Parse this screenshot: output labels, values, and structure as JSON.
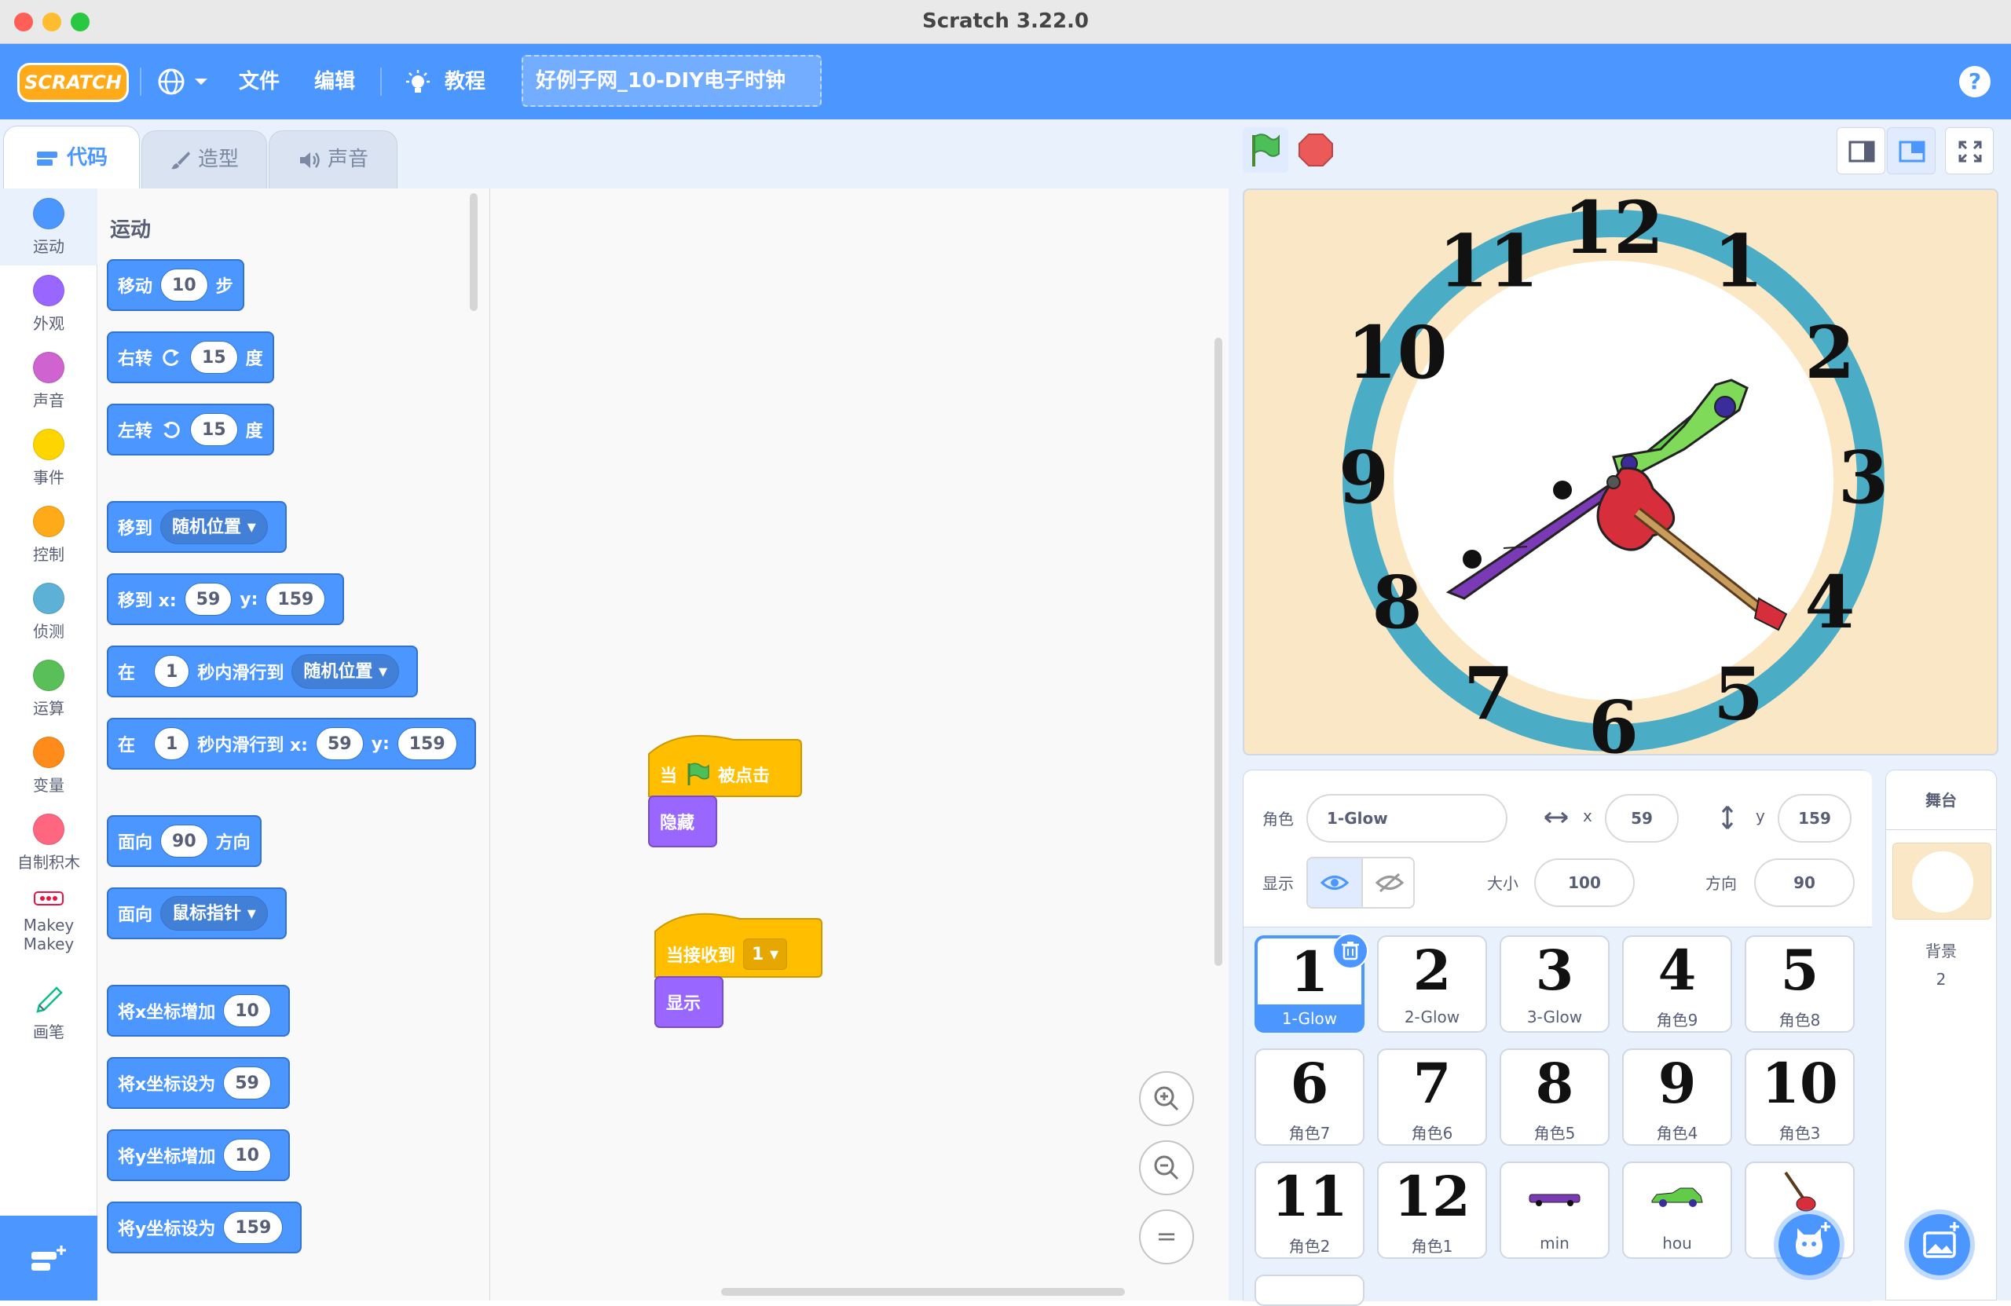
{
  "window": {
    "title": "Scratch 3.22.0"
  },
  "menubar": {
    "logo": "SCRATCH",
    "file": "文件",
    "edit": "编辑",
    "tutorials": "教程",
    "project_title": "好例子网_10-DIY电子时钟",
    "help": "?"
  },
  "tabs": {
    "code": "代码",
    "costumes": "造型",
    "sounds": "声音"
  },
  "categories": [
    {
      "label": "运动",
      "color": "#4c97ff"
    },
    {
      "label": "外观",
      "color": "#9966ff"
    },
    {
      "label": "声音",
      "color": "#cf63cf"
    },
    {
      "label": "事件",
      "color": "#ffd500"
    },
    {
      "label": "控制",
      "color": "#ffab19"
    },
    {
      "label": "侦测",
      "color": "#5cb1d6"
    },
    {
      "label": "运算",
      "color": "#59c059"
    },
    {
      "label": "变量",
      "color": "#ff8c1a"
    },
    {
      "label": "自制积木",
      "color": "#ff6680"
    },
    {
      "label": "Makey\nMakey",
      "color": ""
    },
    {
      "label": "画笔",
      "color": ""
    }
  ],
  "palette": {
    "title": "运动",
    "move": {
      "a": "移动",
      "v": "10",
      "b": "步"
    },
    "turn_right": {
      "a": "右转",
      "v": "15",
      "b": "度"
    },
    "turn_left": {
      "a": "左转",
      "v": "15",
      "b": "度"
    },
    "goto": {
      "a": "移到",
      "dd": "随机位置"
    },
    "goto_xy": {
      "a": "移到 x:",
      "x": "59",
      "ylbl": "y:",
      "y": "159"
    },
    "glide": {
      "a": "在",
      "v": "1",
      "b": "秒内滑行到",
      "dd": "随机位置"
    },
    "glide_xy": {
      "a": "在",
      "v": "1",
      "b": "秒内滑行到 x:",
      "x": "59",
      "ylbl": "y:",
      "y": "159"
    },
    "point_dir": {
      "a": "面向",
      "v": "90",
      "b": "方向"
    },
    "point_to": {
      "a": "面向",
      "dd": "鼠标指针"
    },
    "change_x": {
      "a": "将x坐标增加",
      "v": "10"
    },
    "set_x": {
      "a": "将x坐标设为",
      "v": "59"
    },
    "change_y": {
      "a": "将y坐标增加",
      "v": "10"
    },
    "set_y": {
      "a": "将y坐标设为",
      "v": "159"
    }
  },
  "scripts": {
    "s1": {
      "hat_a": "当",
      "hat_b": "被点击",
      "block": "隐藏"
    },
    "s2": {
      "hat": "当接收到",
      "dd": "1",
      "block": "显示"
    }
  },
  "zoom": {
    "reset": "="
  },
  "sprite_info": {
    "sprite_label": "角色",
    "sprite_name": "1-Glow",
    "x_label": "x",
    "x": "59",
    "y_label": "y",
    "y": "159",
    "show_label": "显示",
    "size_label": "大小",
    "size": "100",
    "dir_label": "方向",
    "dir": "90"
  },
  "sprites": [
    {
      "num": "1",
      "name": "1-Glow"
    },
    {
      "num": "2",
      "name": "2-Glow"
    },
    {
      "num": "3",
      "name": "3-Glow"
    },
    {
      "num": "4",
      "name": "角色9"
    },
    {
      "num": "5",
      "name": "角色8"
    },
    {
      "num": "6",
      "name": "角色7"
    },
    {
      "num": "7",
      "name": "角色6"
    },
    {
      "num": "8",
      "name": "角色5"
    },
    {
      "num": "9",
      "name": "角色4"
    },
    {
      "num": "10",
      "name": "角色3"
    },
    {
      "num": "11",
      "name": "角色2"
    },
    {
      "num": "12",
      "name": "角色1"
    },
    {
      "num": "",
      "name": "min"
    },
    {
      "num": "",
      "name": "hou"
    },
    {
      "num": "",
      "name": ""
    }
  ],
  "stage_pane": {
    "title": "舞台",
    "backdrops_label": "背景",
    "backdrops_count": "2"
  },
  "clock_numbers": [
    "12",
    "1",
    "2",
    "3",
    "4",
    "5",
    "6",
    "7",
    "8",
    "9",
    "10",
    "11"
  ],
  "colors": {
    "accent": "#4c97ff",
    "menubar": "#4c97ff",
    "event": "#ffbf00",
    "looks": "#9966ff"
  }
}
